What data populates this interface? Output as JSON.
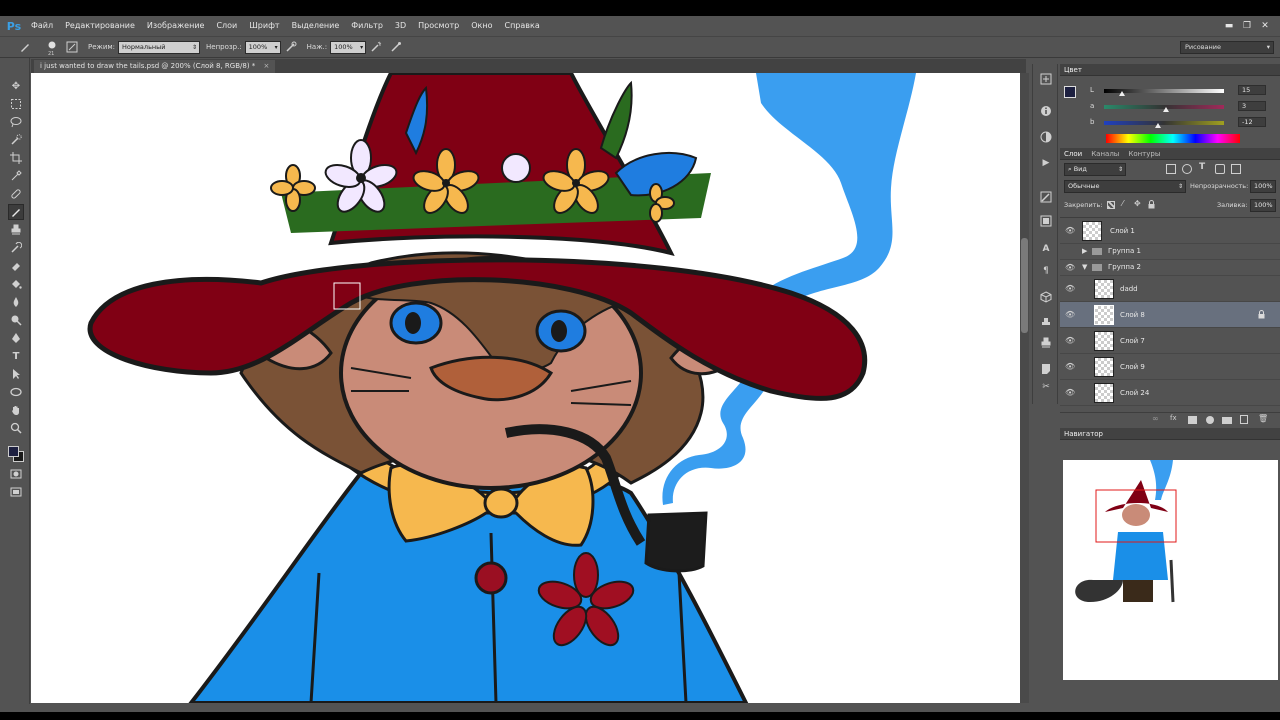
{
  "app": {
    "logo": "Ps"
  },
  "menu": [
    "Файл",
    "Редактирование",
    "Изображение",
    "Слои",
    "Шрифт",
    "Выделение",
    "Фильтр",
    "3D",
    "Просмотр",
    "Окно",
    "Справка"
  ],
  "window_controls": {
    "minimize": "▬",
    "restore": "❐",
    "close": "✕"
  },
  "options": {
    "brush_size": "21",
    "mode_label": "Режим:",
    "mode_value": "Нормальный",
    "opacity_label": "Непрозр.:",
    "opacity_value": "100%",
    "flow_label": "Наж.:",
    "flow_value": "100%",
    "workspace": "Рисование"
  },
  "document": {
    "tab_title": "i just wanted to draw the tails.psd @ 200% (Слой 8, RGB/8) *",
    "close_glyph": "×"
  },
  "color_panel": {
    "title": "Цвет",
    "sliders": [
      {
        "label": "L",
        "value": "15",
        "position": 0.15
      },
      {
        "label": "a",
        "value": "3",
        "position": 0.52
      },
      {
        "label": "b",
        "value": "-12",
        "position": 0.45
      }
    ],
    "foreground": "#1d2040"
  },
  "layers_panel": {
    "tabs": [
      "Слои",
      "Каналы",
      "Контуры"
    ],
    "filter_kind": "Вид",
    "blend_mode": "Обычные",
    "opacity_label": "Непрозрачность:",
    "opacity_value": "100%",
    "lock_label": "Закрепить:",
    "fill_label": "Заливка:",
    "fill_value": "100%",
    "layers": [
      {
        "name": "Слой 1",
        "type": "layer",
        "visible": true
      },
      {
        "name": "Группа 1",
        "type": "group",
        "visible": false,
        "expanded": false
      },
      {
        "name": "Группа 2",
        "type": "group",
        "visible": true,
        "expanded": true
      },
      {
        "name": "dadd",
        "type": "layer",
        "visible": true
      },
      {
        "name": "Слой 8",
        "type": "layer",
        "visible": true,
        "selected": true,
        "locked": true
      },
      {
        "name": "Слой 7",
        "type": "layer",
        "visible": true
      },
      {
        "name": "Слой 9",
        "type": "layer",
        "visible": true
      },
      {
        "name": "Слой 24",
        "type": "layer",
        "visible": true
      }
    ]
  },
  "navigator": {
    "title": "Навигатор"
  },
  "colors": {
    "hat": "#800014",
    "coat": "#1a8fe8",
    "face": "#c98b78",
    "hair": "#7a5236",
    "scarf": "#f6b84e",
    "smoke": "#3a9ef0",
    "ui_bg": "#535353"
  }
}
